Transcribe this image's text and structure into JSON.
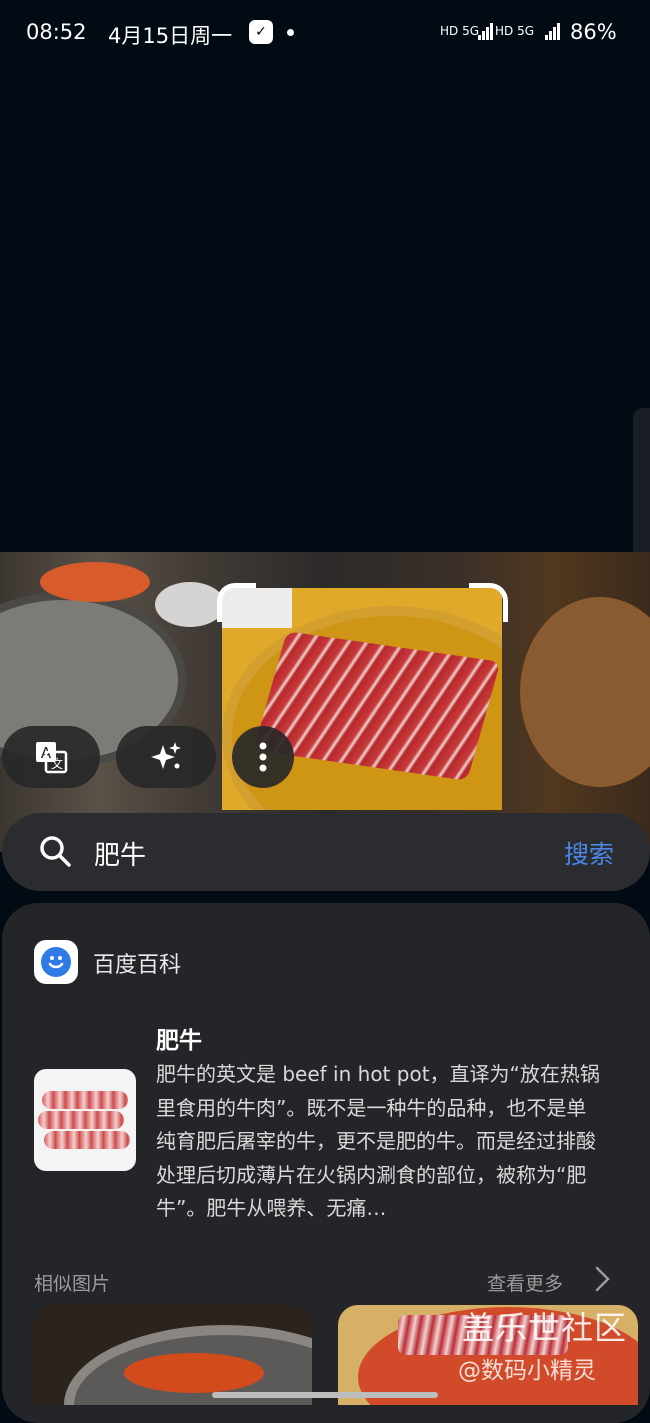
{
  "status_bar": {
    "time": "08:52",
    "date": "4月15日周一",
    "network1": "HD 5G",
    "network2": "HD 5G",
    "battery": "86%"
  },
  "search": {
    "query": "肥牛",
    "button_label": "搜索",
    "accent_color": "#4a86e8"
  },
  "result": {
    "source": "百度百科",
    "title": "肥牛",
    "description": "肥牛的英文是 beef in hot pot，直译为“放在热锅里食用的牛肉”。既不是一种牛的品种，也不是单纯育肥后屠宰的牛，更不是肥的牛。而是经过排酸处理后切成薄片在火锅内涮食的部位，被称为“肥牛”。肥牛从喂养、无痛…"
  },
  "similar": {
    "label": "相似图片",
    "see_more": "查看更多"
  },
  "watermark": {
    "line1": "盖乐世社区",
    "line2": "@数码小精灵"
  },
  "icons": [
    "translate-icon",
    "sparkle-icon",
    "more-vert-icon",
    "search-icon",
    "chevron-right-icon",
    "baidu-baike-logo"
  ]
}
